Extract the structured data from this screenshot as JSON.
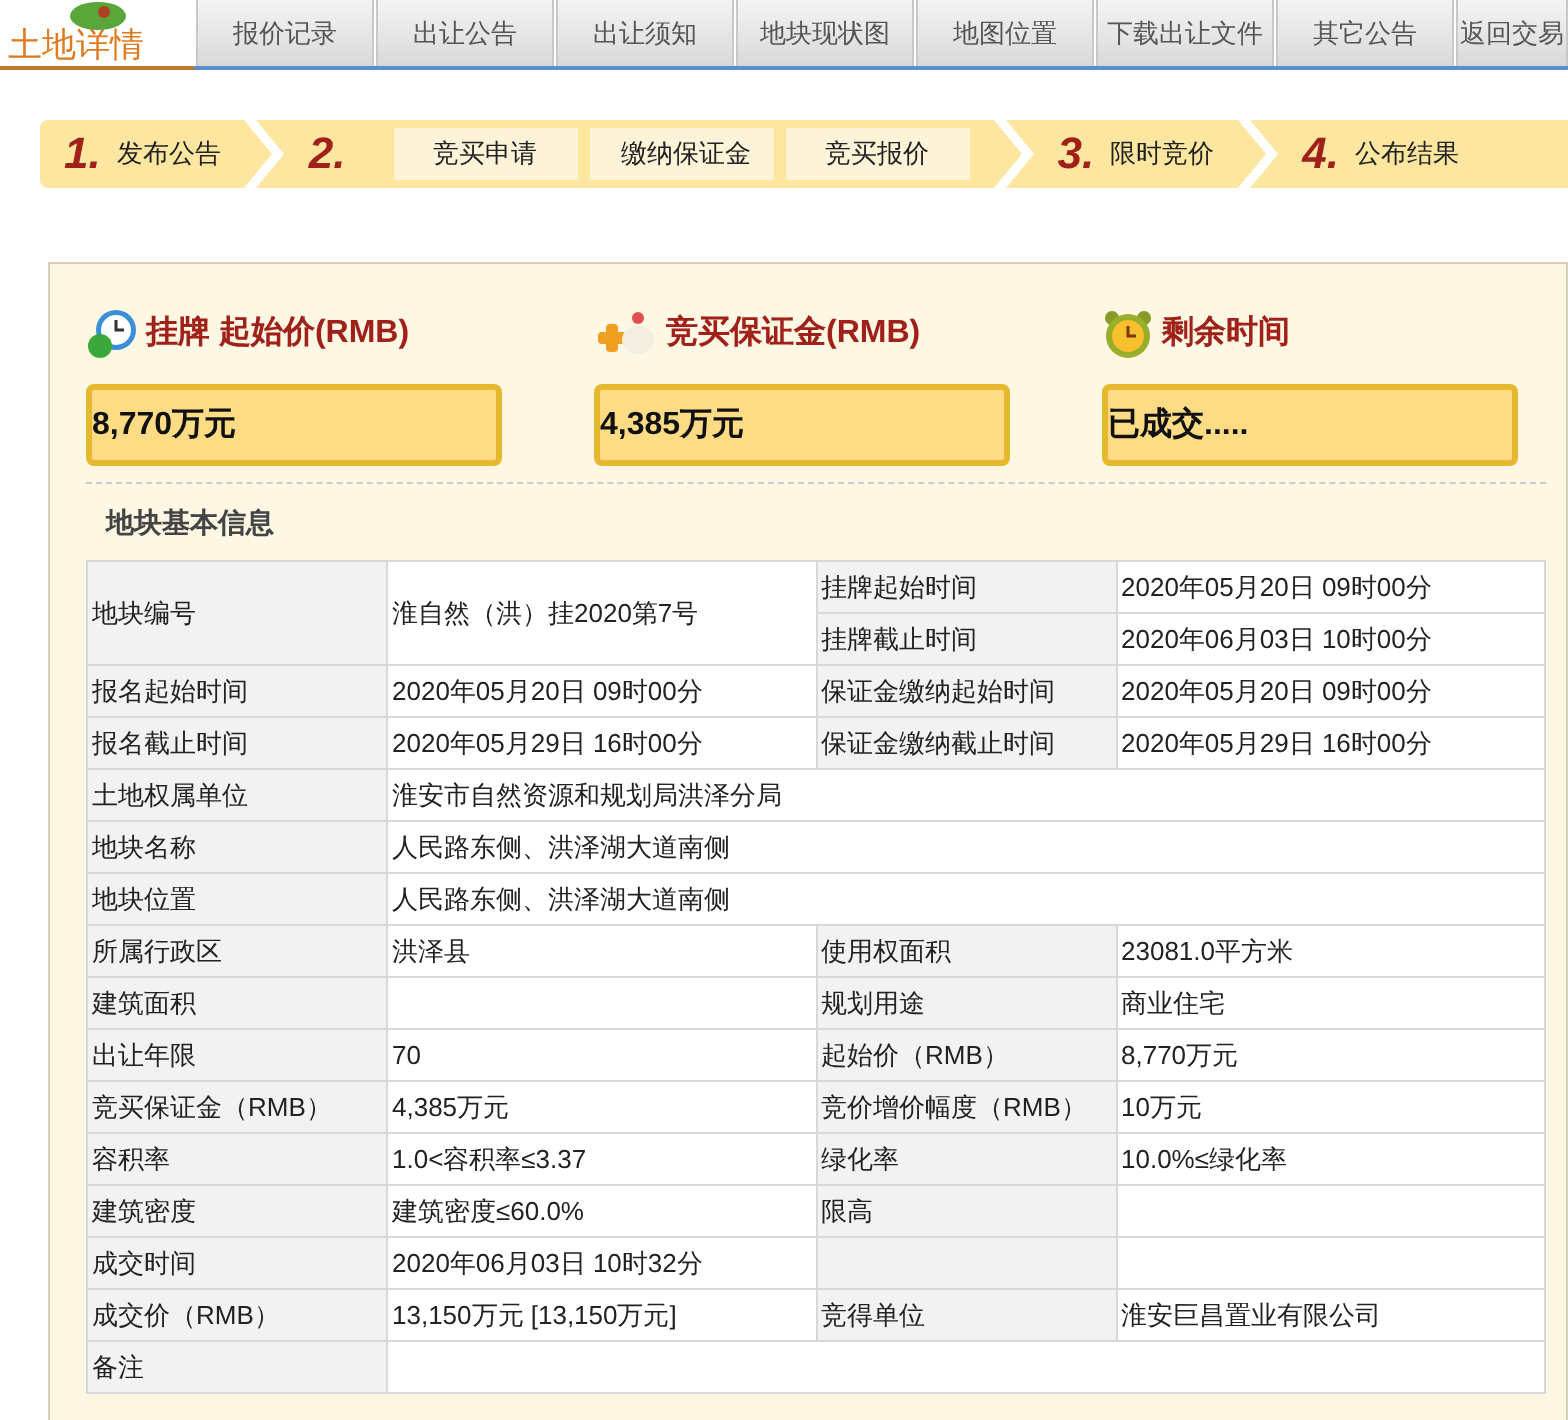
{
  "logo": {
    "title": "土地详情"
  },
  "nav_tabs": [
    {
      "label": "报价记录"
    },
    {
      "label": "出让公告"
    },
    {
      "label": "出让须知"
    },
    {
      "label": "地块现状图"
    },
    {
      "label": "地图位置"
    },
    {
      "label": "下载出让文件"
    },
    {
      "label": "其它公告"
    },
    {
      "label": "返回交易"
    }
  ],
  "steps": [
    {
      "number": "1.",
      "label": "发布公告"
    },
    {
      "number": "2.",
      "actions": [
        "竞买申请",
        "缴纳保证金",
        "竞买报价"
      ]
    },
    {
      "number": "3.",
      "label": "限时竞价"
    },
    {
      "number": "4.",
      "label": "公布结果"
    }
  ],
  "summary": [
    {
      "kind": "price",
      "title": "挂牌 起始价(RMB)",
      "value": "8,770万元"
    },
    {
      "kind": "deposit",
      "title": "竞买保证金(RMB)",
      "value": "4,385万元"
    },
    {
      "kind": "time",
      "title": "剩余时间",
      "value": "已成交....."
    }
  ],
  "section_title": "地块基本信息",
  "info_table": [
    {
      "cells": [
        {
          "kind": "label",
          "text": "地块编号"
        },
        {
          "kind": "value",
          "text": "淮自然（洪）挂2020第7号"
        },
        {
          "kind": "label",
          "text": "挂牌起始时间"
        },
        {
          "kind": "value",
          "text": "2020年05月20日 09时00分"
        }
      ],
      "subrows": [
        [
          {
            "kind": "label",
            "text": "挂牌截止时间"
          },
          {
            "kind": "value",
            "text": "2020年06月03日 10时00分"
          }
        ]
      ]
    },
    {
      "cells": [
        {
          "kind": "label",
          "text": "报名起始时间"
        },
        {
          "kind": "value",
          "text": "2020年05月20日 09时00分"
        },
        {
          "kind": "label",
          "text": "保证金缴纳起始时间"
        },
        {
          "kind": "value",
          "text": "2020年05月20日 09时00分"
        }
      ]
    },
    {
      "cells": [
        {
          "kind": "label",
          "text": "报名截止时间"
        },
        {
          "kind": "value",
          "text": "2020年05月29日 16时00分"
        },
        {
          "kind": "label",
          "text": "保证金缴纳截止时间"
        },
        {
          "kind": "value",
          "text": "2020年05月29日 16时00分"
        }
      ]
    },
    {
      "cells": [
        {
          "kind": "label",
          "text": "土地权属单位"
        },
        {
          "kind": "value",
          "text": "淮安市自然资源和规划局洪泽分局"
        }
      ]
    },
    {
      "cells": [
        {
          "kind": "label",
          "text": "地块名称"
        },
        {
          "kind": "value",
          "text": "人民路东侧、洪泽湖大道南侧"
        }
      ]
    },
    {
      "cells": [
        {
          "kind": "label",
          "text": "地块位置"
        },
        {
          "kind": "value",
          "text": "人民路东侧、洪泽湖大道南侧"
        }
      ]
    },
    {
      "cells": [
        {
          "kind": "label",
          "text": "所属行政区"
        },
        {
          "kind": "value",
          "text": "洪泽县"
        },
        {
          "kind": "label",
          "text": "使用权面积"
        },
        {
          "kind": "value",
          "text": "23081.0平方米"
        }
      ]
    },
    {
      "cells": [
        {
          "kind": "label",
          "text": "建筑面积"
        },
        {
          "kind": "value"
        },
        {
          "kind": "label",
          "text": "规划用途"
        },
        {
          "kind": "value",
          "text": "商业住宅"
        }
      ]
    },
    {
      "cells": [
        {
          "kind": "label",
          "text": "出让年限"
        },
        {
          "kind": "value",
          "text": "70"
        },
        {
          "kind": "label",
          "text": "起始价（RMB）"
        },
        {
          "kind": "value",
          "text": "8,770万元"
        }
      ]
    },
    {
      "cells": [
        {
          "kind": "label",
          "text": "竞买保证金（RMB）"
        },
        {
          "kind": "value",
          "text": "4,385万元"
        },
        {
          "kind": "label",
          "text": "竞价增价幅度（RMB）"
        },
        {
          "kind": "value",
          "text": "10万元"
        }
      ]
    },
    {
      "cells": [
        {
          "kind": "label",
          "text": "容积率"
        },
        {
          "kind": "value",
          "text": "1.0<容积率≤3.37"
        },
        {
          "kind": "label",
          "text": "绿化率"
        },
        {
          "kind": "value",
          "text": "10.0%≤绿化率"
        }
      ]
    },
    {
      "cells": [
        {
          "kind": "label",
          "text": "建筑密度"
        },
        {
          "kind": "value",
          "text": "建筑密度≤60.0%"
        },
        {
          "kind": "label",
          "text": "限高"
        },
        {
          "kind": "value"
        }
      ]
    },
    {
      "cells": [
        {
          "kind": "label",
          "text": "成交时间"
        },
        {
          "kind": "value",
          "text": "2020年06月03日 10时32分"
        },
        {
          "kind": "label"
        },
        {
          "kind": "value"
        }
      ]
    },
    {
      "cells": [
        {
          "kind": "label",
          "text": "成交价（RMB）"
        },
        {
          "kind": "value",
          "text": "13,150万元 [13,150万元]"
        },
        {
          "kind": "label",
          "text": "竞得单位"
        },
        {
          "kind": "value",
          "text": "淮安巨昌置业有限公司"
        }
      ]
    },
    {
      "cells": [
        {
          "kind": "label",
          "text": "备注"
        },
        {
          "kind": "value"
        }
      ]
    }
  ]
}
